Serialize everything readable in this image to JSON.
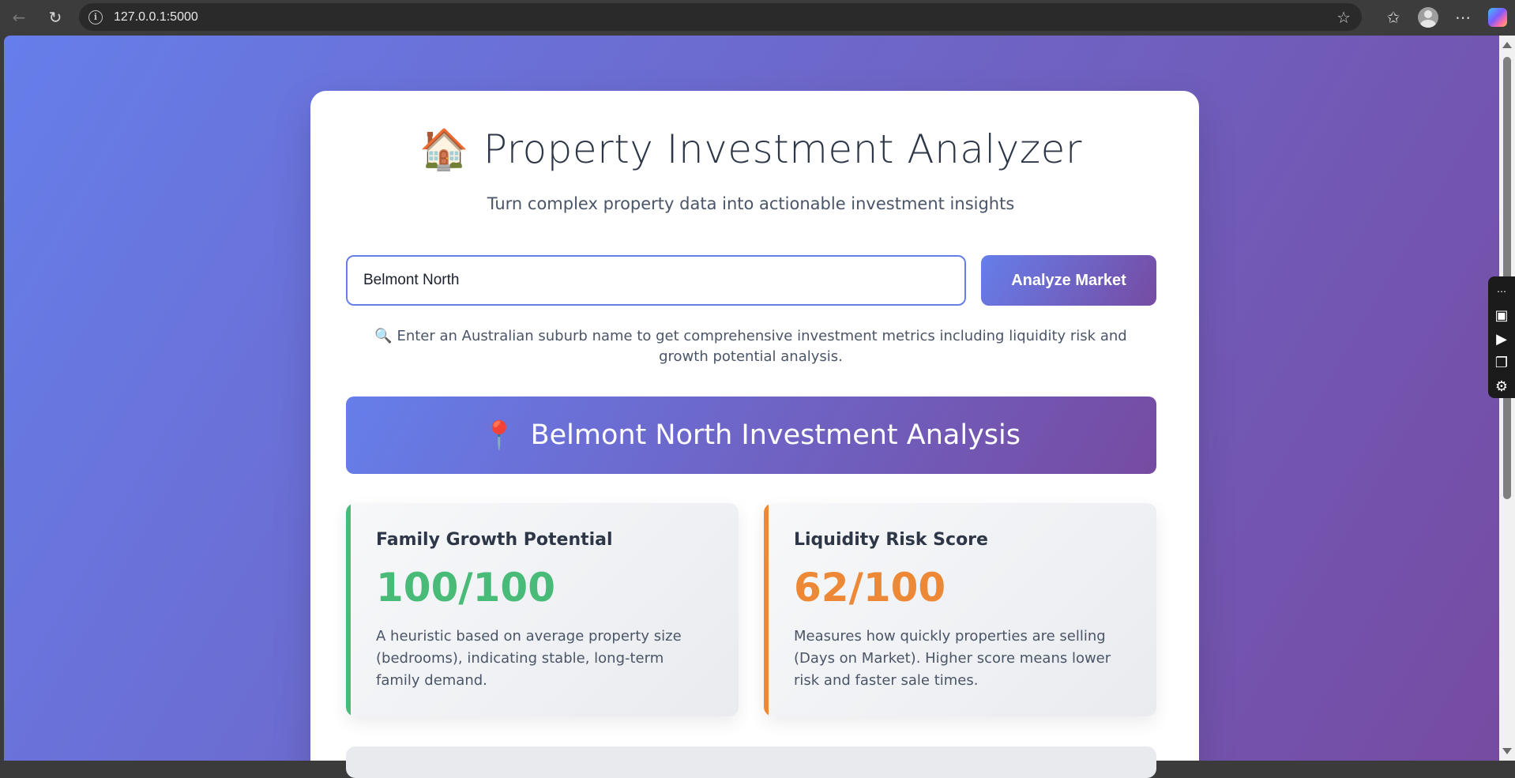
{
  "browser": {
    "url": "127.0.0.1:5000",
    "back_icon": "arrow-left-icon",
    "reload_icon": "reload-icon",
    "info_icon": "info-icon",
    "star_icon": "star-icon",
    "favorites_icon": "favorites-icon",
    "profile_icon": "profile-icon",
    "menu_icon": "more-icon",
    "copilot_icon": "copilot-icon"
  },
  "header": {
    "title_icon": "🏠",
    "title": "Property Investment Analyzer",
    "subtitle": "Turn complex property data into actionable investment insights"
  },
  "search": {
    "value": "Belmont North",
    "button_label": "Analyze Market",
    "hint_icon": "🔍",
    "hint": "Enter an Australian suburb name to get comprehensive investment metrics including liquidity risk and growth potential analysis."
  },
  "result": {
    "pin_icon": "📍",
    "heading": "Belmont North Investment Analysis"
  },
  "metrics": [
    {
      "title": "Family Growth Potential",
      "value": "100/100",
      "description": "A heuristic based on average property size (bedrooms), indicating stable, long-term family demand.",
      "color": "#48bb78"
    },
    {
      "title": "Liquidity Risk Score",
      "value": "62/100",
      "description": "Measures how quickly properties are selling (Days on Market). Higher score means lower risk and faster sale times.",
      "color": "#ed8936"
    }
  ],
  "colors": {
    "gradient_start": "#667eea",
    "gradient_end": "#764ba2"
  }
}
